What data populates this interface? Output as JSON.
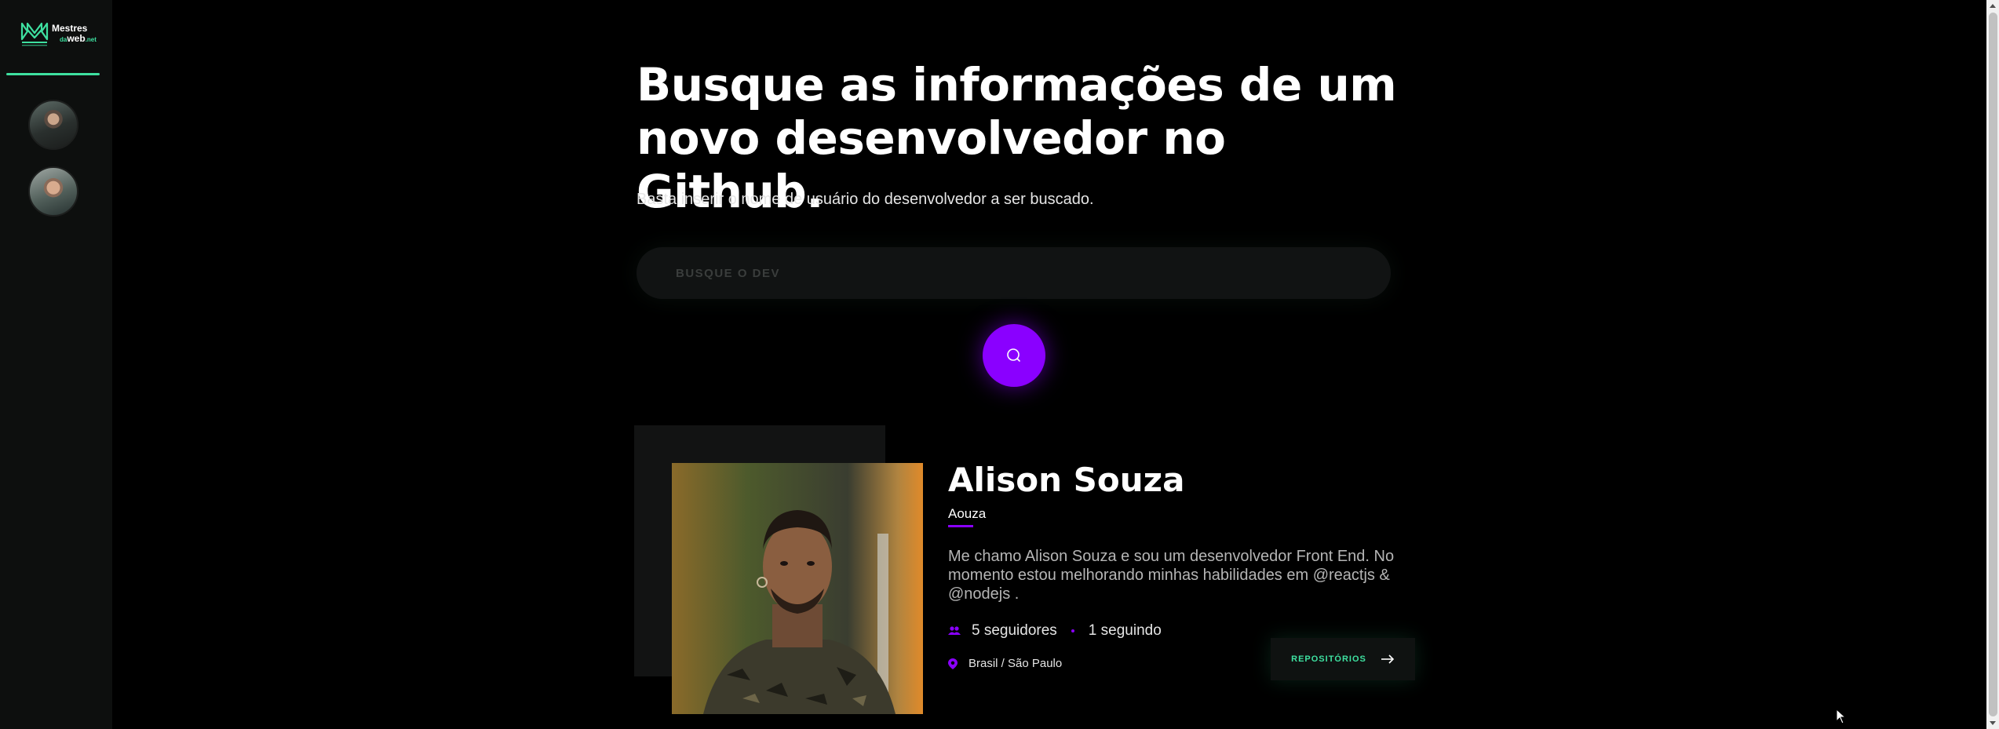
{
  "sidebar": {
    "logo": {
      "line1": "Mestres",
      "line2_prefix": "da",
      "line2": "web",
      "line2_suffix": ".net"
    },
    "avatars": [
      {
        "icon": "user-avatar-1"
      },
      {
        "icon": "user-avatar-2"
      }
    ]
  },
  "hero": {
    "title_line1": "Busque as informações de um",
    "title_line2": "novo desenvolvedor no Github.",
    "subtitle": "Basta inserir o nome de usuário do desenvolvedor a ser buscado."
  },
  "search": {
    "placeholder": "BUSQUE O DEV",
    "value": "",
    "button_icon": "search-icon",
    "button_color": "#8a00ff"
  },
  "profile": {
    "name": "Alison Souza",
    "login": "Aouza",
    "bio": "Me chamo Alison Souza e sou um desenvolvedor Front End. No momento estou melhorando minhas habilidades em @reactjs & @nodejs .",
    "followers": "5 seguidores",
    "following": "1 seguindo",
    "location": "Brasil / São Paulo",
    "repos_label": "REPOSITÓRIOS"
  },
  "colors": {
    "accent_green": "#3ee0a0",
    "accent_purple": "#8a00ff",
    "background": "#000000",
    "sidebar": "#0d0f0e"
  }
}
